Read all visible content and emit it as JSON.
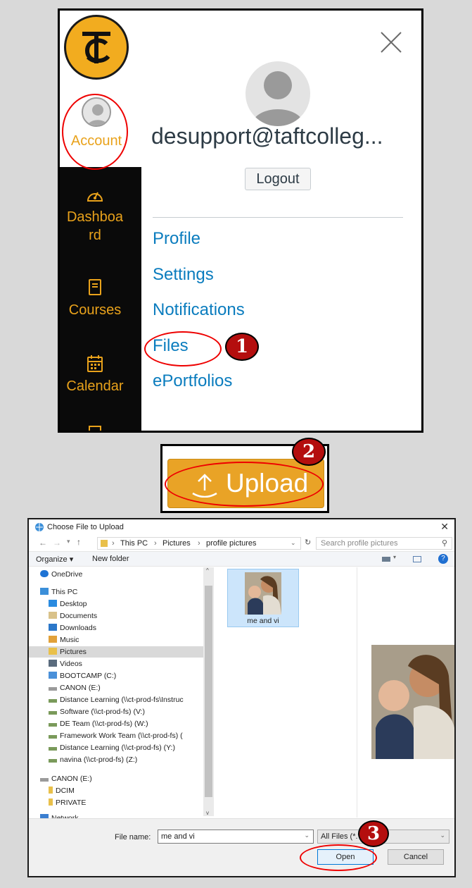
{
  "account_tray": {
    "nav": {
      "account_label": "Account",
      "dashboard_line1": "Dashboa",
      "dashboard_line2": "rd",
      "courses_label": "Courses",
      "calendar_label": "Calendar"
    },
    "logo_text": "TC",
    "email": "desupport@taftcolleg...",
    "logout_label": "Logout",
    "links": [
      "Profile",
      "Settings",
      "Notifications",
      "Files",
      "ePortfolios"
    ]
  },
  "upload": {
    "label": "Upload"
  },
  "annotations": {
    "step1": "1",
    "step2": "2",
    "step3": "3",
    "color": "#e00000"
  },
  "file_dialog": {
    "title": "Choose File to Upload",
    "close_glyph": "✕",
    "breadcrumb": [
      "This PC",
      "Pictures",
      "profile pictures"
    ],
    "search_placeholder": "Search profile pictures",
    "organize_label": "Organize",
    "new_folder_label": "New folder",
    "nav_items": [
      "OneDrive",
      "This PC",
      "Desktop",
      "Documents",
      "Downloads",
      "Music",
      "Pictures",
      "Videos",
      "BOOTCAMP (C:)",
      "CANON (E:)",
      "Distance Learning (\\\\ct-prod-fs\\Instruc",
      "Software (\\\\ct-prod-fs) (V:)",
      "DE Team (\\\\ct-prod-fs) (W:)",
      "Framework Work Team (\\\\ct-prod-fs) (",
      "Distance Learning (\\\\ct-prod-fs) (Y:)",
      "navina (\\\\ct-prod-fs) (Z:)",
      "CANON (E:)",
      "DCIM",
      "PRIVATE",
      "Network"
    ],
    "selected_file": "me and vi",
    "file_name_label": "File name:",
    "file_name_value": "me and vi",
    "filter_value": "All Files (*.*)",
    "open_label": "Open",
    "cancel_label": "Cancel"
  },
  "colors": {
    "canvas_gold": "#e9a21b",
    "link_blue": "#0a7cbe",
    "upload_bg": "#e9a326"
  }
}
